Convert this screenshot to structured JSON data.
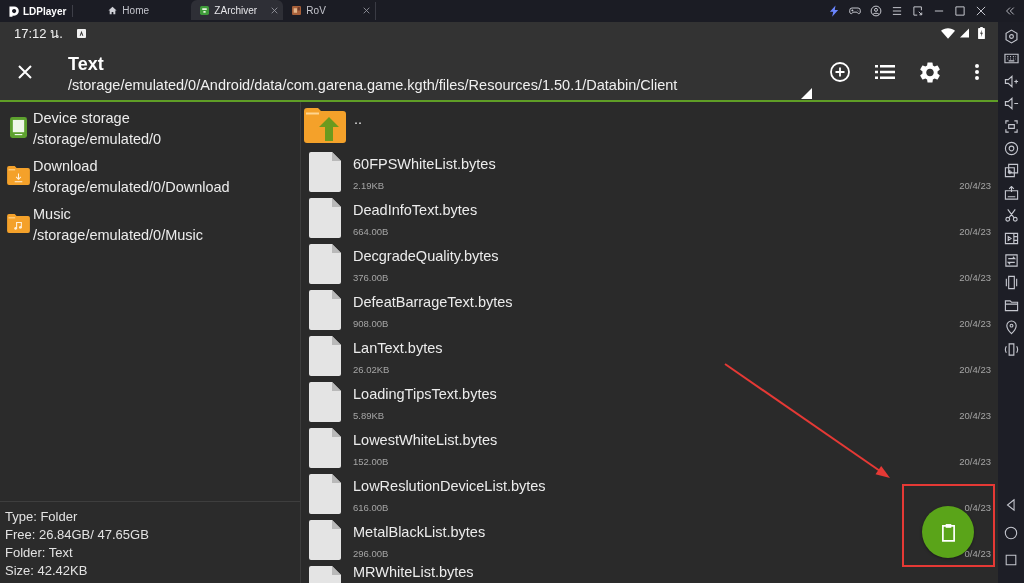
{
  "emulator": {
    "brand": "LDPlayer",
    "tabs": [
      {
        "label": "Home",
        "kind": "home",
        "selected": false,
        "closable": false
      },
      {
        "label": "ZArchiver",
        "kind": "app",
        "selected": true,
        "closable": true
      },
      {
        "label": "RoV",
        "kind": "game",
        "selected": false,
        "closable": true
      }
    ]
  },
  "status_bar": {
    "time": "17:12 น."
  },
  "toolbar": {
    "title": "Text",
    "path": "/storage/emulated/0/Android/data/com.garena.game.kgth/files/Resources/1.50.1/Databin/Client"
  },
  "places": [
    {
      "kind": "storage",
      "name": "Device storage",
      "path": "/storage/emulated/0"
    },
    {
      "kind": "download",
      "name": "Download",
      "path": "/storage/emulated/0/Download"
    },
    {
      "kind": "music",
      "name": "Music",
      "path": "/storage/emulated/0/Music"
    }
  ],
  "folder_info": [
    "Type: Folder",
    "Free: 26.84GB/ 47.65GB",
    "Folder: Text",
    "Size: 42.42KB"
  ],
  "files": [
    {
      "kind": "parent",
      "name": ".."
    },
    {
      "kind": "file",
      "name": "60FPSWhiteList.bytes",
      "size": "2.19KB",
      "date": "20/4/23"
    },
    {
      "kind": "file",
      "name": "DeadInfoText.bytes",
      "size": "664.00B",
      "date": "20/4/23"
    },
    {
      "kind": "file",
      "name": "DecgradeQuality.bytes",
      "size": "376.00B",
      "date": "20/4/23"
    },
    {
      "kind": "file",
      "name": "DefeatBarrageText.bytes",
      "size": "908.00B",
      "date": "20/4/23"
    },
    {
      "kind": "file",
      "name": "LanText.bytes",
      "size": "26.02KB",
      "date": "20/4/23"
    },
    {
      "kind": "file",
      "name": "LoadingTipsText.bytes",
      "size": "5.89KB",
      "date": "20/4/23"
    },
    {
      "kind": "file",
      "name": "LowestWhiteList.bytes",
      "size": "152.00B",
      "date": "20/4/23"
    },
    {
      "kind": "file",
      "name": "LowReslutionDeviceList.bytes",
      "size": "616.00B",
      "date": "0/4/23"
    },
    {
      "kind": "file",
      "name": "MetalBlackList.bytes",
      "size": "296.00B",
      "date": "0/4/23"
    },
    {
      "kind": "file",
      "name": "MRWhiteList.bytes"
    }
  ]
}
